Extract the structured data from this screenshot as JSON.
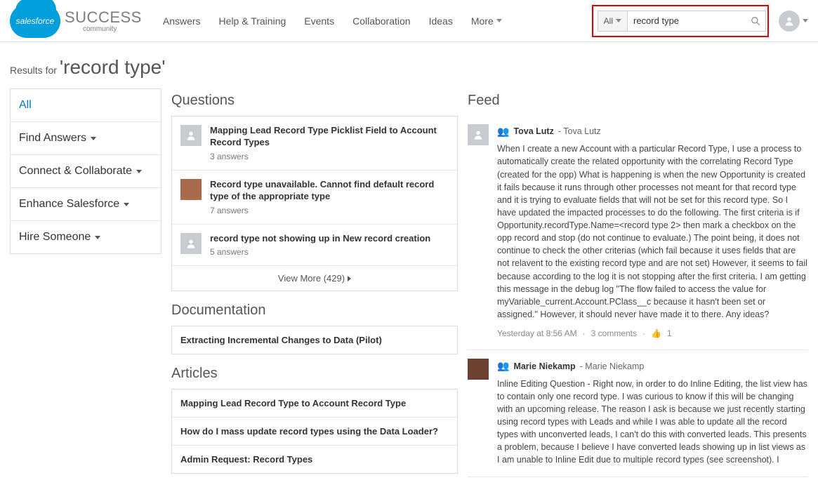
{
  "header": {
    "logo_text": "salesforce",
    "brand_big": "SUCCESS",
    "brand_small": "community",
    "nav": [
      "Answers",
      "Help & Training",
      "Events",
      "Collaboration",
      "Ideas",
      "More"
    ],
    "search_scope": "All",
    "search_value": "record type"
  },
  "results": {
    "prefix": "Results for ",
    "query": "'record type'"
  },
  "sidebar": {
    "items": [
      {
        "label": "All",
        "active": true,
        "caret": false
      },
      {
        "label": "Find Answers",
        "caret": true
      },
      {
        "label": "Connect & Collaborate",
        "caret": true
      },
      {
        "label": "Enhance Salesforce",
        "caret": true
      },
      {
        "label": "Hire Someone",
        "caret": true
      }
    ]
  },
  "questions": {
    "title": "Questions",
    "items": [
      {
        "title": "Mapping Lead Record Type Picklist Field to Account Record Types",
        "meta": "3 answers",
        "photo": false
      },
      {
        "title": "Record type unavailable. Cannot find default record type of the appropriate type",
        "meta": "7 answers",
        "photo": true
      },
      {
        "title": "record type not showing up in New record creation",
        "meta": "5 answers",
        "photo": false
      }
    ],
    "view_more": "View More (429)"
  },
  "documentation": {
    "title": "Documentation",
    "items": [
      "Extracting Incremental Changes to Data (Pilot)"
    ]
  },
  "articles": {
    "title": "Articles",
    "items": [
      "Mapping Lead Record Type to Account Record Type",
      "How do I mass update record types using the Data Loader?",
      "Admin Request: Record Types"
    ]
  },
  "feed": {
    "title": "Feed",
    "items": [
      {
        "author": "Tova Lutz",
        "suffix": " - Tova Lutz",
        "photo": false,
        "body": "When I create a new Account with a particular Record Type, I use a process to automatically create the related opportunity with the correlating Record Type (created for the opp)   What is happening is when the new Opportunity is created it fails because it runs through other processes not meant for that record type and it is trying to evaluate fields that will not be set for this record type.   So I have updated the impacted processes to do the following. The first criteria is if Opportunity.recordType.Name=<record type 2> then mark a checkbox on the opp record and stop (do not continue to evaluate.) The point being,  it does not continue to check the other criterias (which fail because it uses fields that are not relavent to the existing record type and are not set) However, it seems to fail because according to the log it is not stopping after the first criteria. I am getting this message in the debug log \"The flow failed to access the value for myVariable_current.Account.PClass__c because it hasn't been set or assigned.\"  However, it should never have made it to there.    Any ideas?",
        "meta_time": "Yesterday at 8:56 AM",
        "meta_comments": "3 comments",
        "likes": "1"
      },
      {
        "author": "Marie Niekamp",
        "suffix": " - Marie Niekamp",
        "photo": true,
        "body": "Inline Editing Question - Right now, in order to do Inline Editing, the list view has to contain only one record type. I was curious to know if this will be changing with an upcoming release.    The reason I ask is because we just recently starting using record types with Leads and while I was able to update all the record types with unconverted leads, I can't do this with converted leads. This presents a problem, because I believe I have converted leads showing up in list views as I am unable to Inline Edit due to multiple record types (see screenshot). I"
      }
    ]
  }
}
